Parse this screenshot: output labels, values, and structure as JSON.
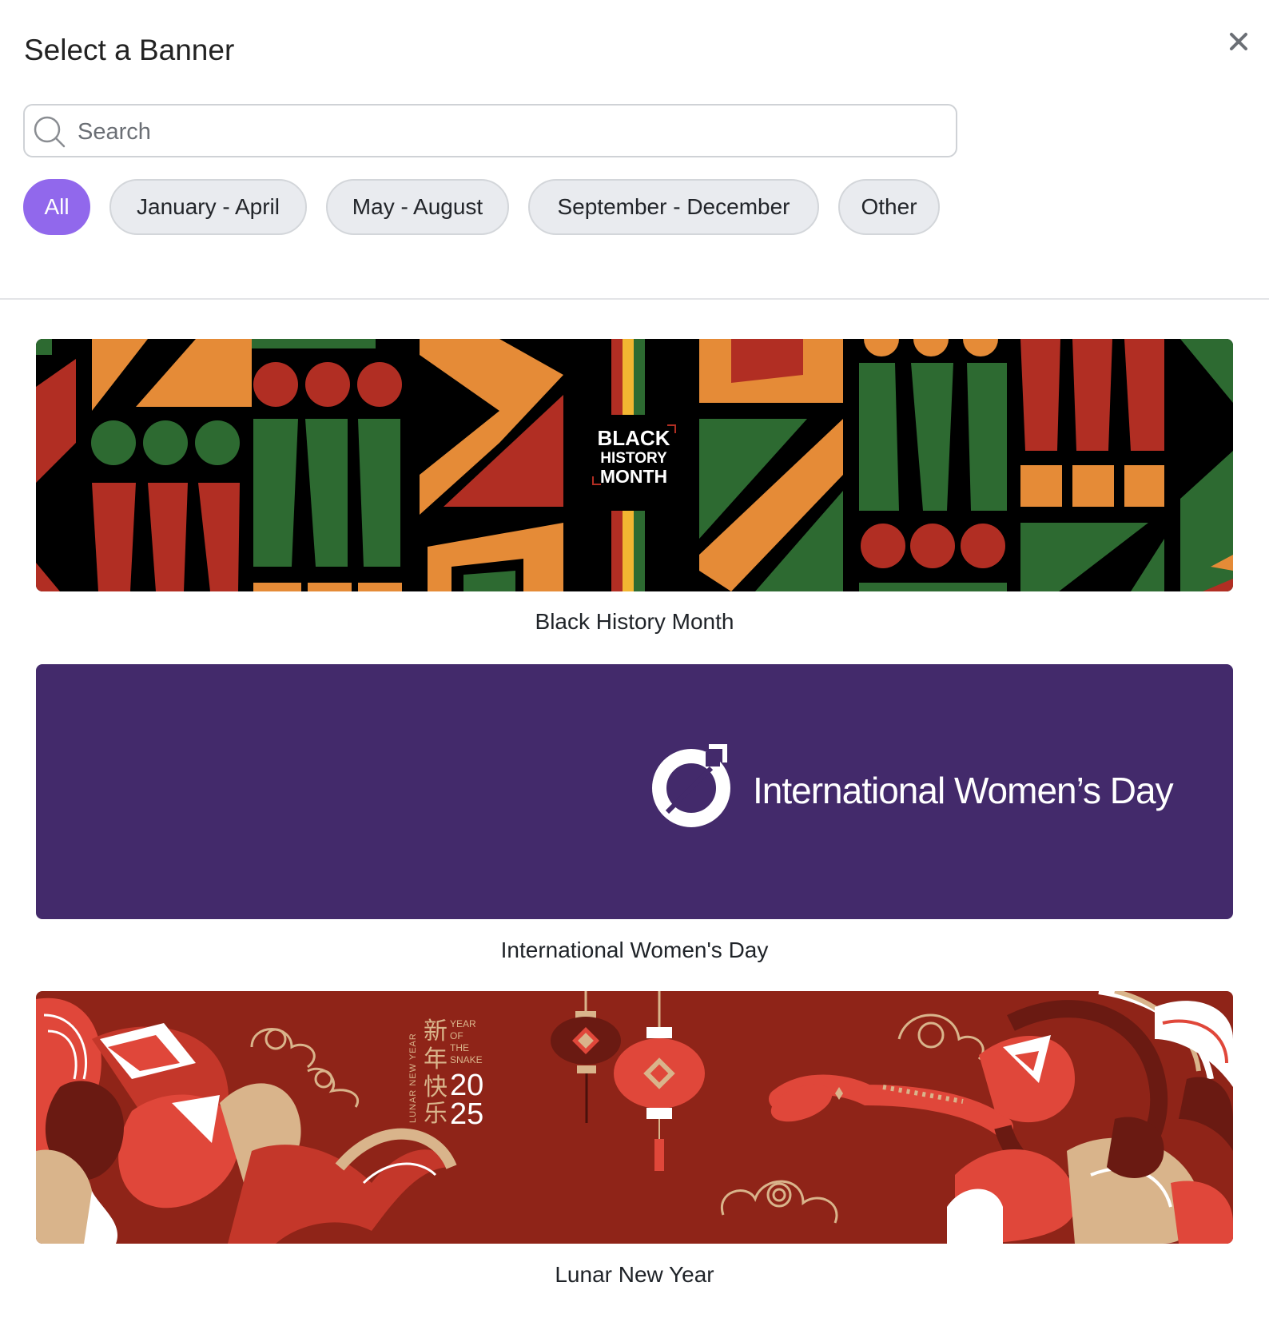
{
  "modal": {
    "title": "Select a Banner",
    "close_icon": "close-icon"
  },
  "search": {
    "placeholder": "Search",
    "value": "",
    "icon": "search-icon"
  },
  "filters": [
    {
      "label": "All",
      "active": true
    },
    {
      "label": "January - April",
      "active": false
    },
    {
      "label": "May - August",
      "active": false
    },
    {
      "label": "September - December",
      "active": false
    },
    {
      "label": "Other",
      "active": false
    }
  ],
  "banners": [
    {
      "caption": "Black History Month",
      "art": {
        "line1": "BLACK",
        "line2": "HISTORY",
        "line3": "MONTH"
      },
      "colors": [
        "#000000",
        "#2d6a31",
        "#b12e23",
        "#e58b37",
        "#f2b632"
      ]
    },
    {
      "caption": "International Women's Day",
      "art": {
        "logo_text": "International Women’s Day"
      },
      "colors": [
        "#432a6b",
        "#ffffff"
      ]
    },
    {
      "caption": "Lunar New Year",
      "art": {
        "vertical_text": "LUNAR NEW YEAR",
        "chars": [
          "新",
          "年",
          "快",
          "乐"
        ],
        "year_of": [
          "YEAR",
          "OF",
          "THE",
          "SNAKE"
        ],
        "year_top": "20",
        "year_bottom": "25"
      },
      "colors": [
        "#8f2418",
        "#d9b48b",
        "#e0473a",
        "#ffffff"
      ]
    }
  ],
  "accent_color": "#9168ec"
}
